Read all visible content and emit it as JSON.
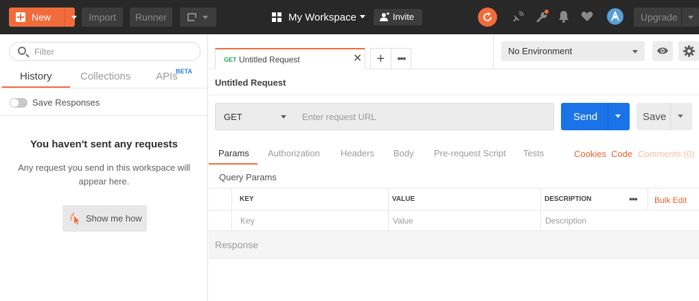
{
  "colors": {
    "accent": "#f26b3a",
    "header_bg": "#282828",
    "send_blue": "#1a73e8",
    "get_green": "#2f9e5c",
    "link_orange": "#e8622e"
  },
  "header": {
    "new_label": "New",
    "import_label": "Import",
    "runner_label": "Runner",
    "workspace_label": "My Workspace",
    "invite_label": "Invite",
    "upgrade_label": "Upgrade",
    "icons": [
      "new-window-icon",
      "grid-icon",
      "user-plus-icon",
      "sync-icon",
      "satellite-icon",
      "wrench-icon",
      "bell-icon",
      "heart-icon",
      "avatar-icon"
    ]
  },
  "sidebar": {
    "filter_placeholder": "Filter",
    "tabs": [
      {
        "label": "History",
        "active": true
      },
      {
        "label": "Collections",
        "active": false
      },
      {
        "label": "APIs",
        "active": false,
        "badge": "BETA"
      }
    ],
    "save_responses_label": "Save Responses",
    "save_responses_on": false,
    "empty_title": "You haven't sent any requests",
    "empty_description": "Any request you send in this workspace will appear here.",
    "show_me_how_label": "Show me how"
  },
  "tab": {
    "method": "GET",
    "name": "Untitled Request",
    "close": "✕",
    "add": "+",
    "more": "•••"
  },
  "environment": {
    "selected": "No Environment"
  },
  "request": {
    "title": "Untitled Request",
    "method": "GET",
    "url_value": "",
    "url_placeholder": "Enter request URL",
    "send_label": "Send",
    "save_label": "Save",
    "tabs": [
      {
        "label": "Params",
        "active": true
      },
      {
        "label": "Authorization",
        "active": false
      },
      {
        "label": "Headers",
        "active": false
      },
      {
        "label": "Body",
        "active": false
      },
      {
        "label": "Pre-request Script",
        "active": false
      },
      {
        "label": "Tests",
        "active": false
      }
    ],
    "cookies_label": "Cookies",
    "code_label": "Code",
    "comments_label": "Comments (0)"
  },
  "params": {
    "section_label": "Query Params",
    "headers": [
      "KEY",
      "VALUE",
      "DESCRIPTION"
    ],
    "placeholders": [
      "Key",
      "Value",
      "Description"
    ],
    "more": "•••",
    "bulk_edit_label": "Bulk Edit"
  },
  "response": {
    "label": "Response"
  }
}
